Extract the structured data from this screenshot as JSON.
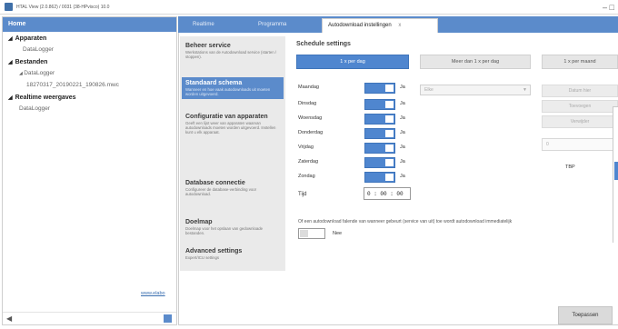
{
  "window": {
    "title": "HTAL View (2.0.862) / 0031 (38-HPvisco) 10.0",
    "controls": "–  □"
  },
  "sidebar": {
    "header": "Home",
    "groups": [
      {
        "label": "Apparaten",
        "items": [
          "DataLogger"
        ]
      },
      {
        "label": "Bestanden",
        "items": [
          "DataLogger",
          "18270317_20190221_190826.mwc"
        ]
      },
      {
        "label": "Realtime weergaves",
        "items": [
          "DataLogger"
        ]
      }
    ],
    "footer_link": "www.elabo"
  },
  "tabs": [
    {
      "label": "Realtime",
      "active": false
    },
    {
      "label": "Programma",
      "active": false
    },
    {
      "label": "Autodownload instellingen",
      "active": true,
      "close": "x"
    }
  ],
  "menu": [
    {
      "title": "Beheer service",
      "desc": "Werkstations van de Autodownload service (starten / stoppen).",
      "active": false
    },
    {
      "title": "Standaard schema",
      "desc": "Wanneer en hoe vaak autodownloads uit moeten worden uitgevoerd.",
      "active": true
    },
    {
      "title": "Configuratie van apparaten",
      "desc": "Geeft een lijst weer van apparaten waarvan autodownloads moeten worden uitgevoerd. Instellen kunt u elk apparaat.",
      "active": false
    },
    {
      "title": "Database connectie",
      "desc": "Configureer de database-verbinding voor autodownload.",
      "active": false
    },
    {
      "title": "Doelmap",
      "desc": "Doelmap voor het opslaan van gedownloade bestanden.",
      "active": false
    },
    {
      "title": "Advanced settings",
      "desc": "Expert/ICU settings",
      "active": false
    }
  ],
  "schedule": {
    "title": "Schedule settings",
    "modes": [
      {
        "label": "1 x per dag",
        "active": true
      },
      {
        "label": "Meer dan 1 x per dag",
        "active": false
      },
      {
        "label": "1 x per maand",
        "active": false
      }
    ],
    "days": [
      {
        "name": "Maandag",
        "value": "Ja"
      },
      {
        "name": "Dinsdag",
        "value": "Ja"
      },
      {
        "name": "Woensdag",
        "value": "Ja"
      },
      {
        "name": "Donderdag",
        "value": "Ja"
      },
      {
        "name": "Vrijdag",
        "value": "Ja"
      },
      {
        "name": "Zaterdag",
        "value": "Ja"
      },
      {
        "name": "Zondag",
        "value": "Ja"
      }
    ],
    "time_label": "Tijd",
    "time_value": "0 : 00 : 00",
    "dropdown_value": "Elke",
    "right_buttons": [
      "Datum hier",
      "Toevoegen",
      "Verwijder"
    ],
    "right_input": "0",
    "tbp_label": "TBP",
    "hint": "Of een autodownload falende van wanneer gebeurt (service van uit) toe wordt autodownload immediatelijk",
    "toggle_label": "Nee"
  },
  "footer": {
    "apply_button": "Toepassen"
  }
}
